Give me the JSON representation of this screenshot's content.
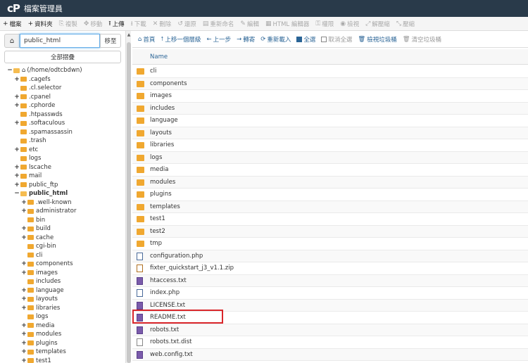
{
  "header": {
    "logo": "cP",
    "title": "檔案管理員"
  },
  "toolbar": [
    {
      "label": "檔案",
      "icon": "+",
      "name": "new-file-button",
      "enabled": true
    },
    {
      "label": "資料夾",
      "icon": "+",
      "name": "new-folder-button",
      "enabled": true
    },
    {
      "label": "複製",
      "icon": "⎘",
      "name": "copy-button",
      "enabled": false
    },
    {
      "label": "移動",
      "icon": "✥",
      "name": "move-button",
      "enabled": false
    },
    {
      "label": "上傳",
      "icon": "⭱",
      "name": "upload-button",
      "enabled": true
    },
    {
      "label": "下載",
      "icon": "⭳",
      "name": "download-button",
      "enabled": false
    },
    {
      "label": "刪除",
      "icon": "✕",
      "name": "delete-button",
      "enabled": false
    },
    {
      "label": "還原",
      "icon": "↺",
      "name": "restore-button",
      "enabled": false
    },
    {
      "label": "重新命名",
      "icon": "▤",
      "name": "rename-button",
      "enabled": false
    },
    {
      "label": "編輯",
      "icon": "✎",
      "name": "edit-button",
      "enabled": false
    },
    {
      "label": "HTML 編輯器",
      "icon": "▦",
      "name": "html-editor-button",
      "enabled": false
    },
    {
      "label": "權限",
      "icon": "⚿",
      "name": "permissions-button",
      "enabled": false
    },
    {
      "label": "檢視",
      "icon": "◉",
      "name": "view-button",
      "enabled": false
    },
    {
      "label": "解壓縮",
      "icon": "⤢",
      "name": "extract-button",
      "enabled": false
    },
    {
      "label": "壓縮",
      "icon": "⤡",
      "name": "compress-button",
      "enabled": false
    }
  ],
  "left": {
    "path_value": "public_html",
    "go_label": "移至",
    "collapse_label": "全部摺疊",
    "tree": [
      {
        "label": "(/home/odtcbdwn)",
        "depth": 0,
        "toggle": "−",
        "home": true,
        "open": true
      },
      {
        "label": ".cagefs",
        "depth": 1,
        "toggle": "+"
      },
      {
        "label": ".cl.selector",
        "depth": 1,
        "toggle": ""
      },
      {
        "label": ".cpanel",
        "depth": 1,
        "toggle": "+"
      },
      {
        "label": ".cphorde",
        "depth": 1,
        "toggle": "+"
      },
      {
        "label": ".htpasswds",
        "depth": 1,
        "toggle": ""
      },
      {
        "label": ".softaculous",
        "depth": 1,
        "toggle": "+"
      },
      {
        "label": ".spamassassin",
        "depth": 1,
        "toggle": ""
      },
      {
        "label": ".trash",
        "depth": 1,
        "toggle": ""
      },
      {
        "label": "etc",
        "depth": 1,
        "toggle": "+"
      },
      {
        "label": "logs",
        "depth": 1,
        "toggle": ""
      },
      {
        "label": "lscache",
        "depth": 1,
        "toggle": "+"
      },
      {
        "label": "mail",
        "depth": 1,
        "toggle": "+"
      },
      {
        "label": "public_ftp",
        "depth": 1,
        "toggle": "+"
      },
      {
        "label": "public_html",
        "depth": 1,
        "toggle": "−",
        "bold": true,
        "open": true
      },
      {
        "label": ".well-known",
        "depth": 2,
        "toggle": "+"
      },
      {
        "label": "administrator",
        "depth": 2,
        "toggle": "+"
      },
      {
        "label": "bin",
        "depth": 2,
        "toggle": ""
      },
      {
        "label": "build",
        "depth": 2,
        "toggle": "+"
      },
      {
        "label": "cache",
        "depth": 2,
        "toggle": "+"
      },
      {
        "label": "cgi-bin",
        "depth": 2,
        "toggle": ""
      },
      {
        "label": "cli",
        "depth": 2,
        "toggle": ""
      },
      {
        "label": "components",
        "depth": 2,
        "toggle": "+"
      },
      {
        "label": "images",
        "depth": 2,
        "toggle": "+"
      },
      {
        "label": "includes",
        "depth": 2,
        "toggle": ""
      },
      {
        "label": "language",
        "depth": 2,
        "toggle": "+"
      },
      {
        "label": "layouts",
        "depth": 2,
        "toggle": "+"
      },
      {
        "label": "libraries",
        "depth": 2,
        "toggle": "+"
      },
      {
        "label": "logs",
        "depth": 2,
        "toggle": ""
      },
      {
        "label": "media",
        "depth": 2,
        "toggle": "+"
      },
      {
        "label": "modules",
        "depth": 2,
        "toggle": "+"
      },
      {
        "label": "plugins",
        "depth": 2,
        "toggle": "+"
      },
      {
        "label": "templates",
        "depth": 2,
        "toggle": "+"
      },
      {
        "label": "test1",
        "depth": 2,
        "toggle": "+"
      }
    ]
  },
  "nav": [
    {
      "label": "首頁",
      "icon": "⌂",
      "name": "home-nav-button"
    },
    {
      "label": "上移一個層級",
      "icon": "⭡",
      "name": "up-level-button"
    },
    {
      "label": "上一步",
      "icon": "←",
      "name": "back-button"
    },
    {
      "label": "轉寄",
      "icon": "→",
      "name": "forward-button"
    },
    {
      "label": "重新載入",
      "icon": "⟳",
      "name": "reload-button"
    },
    {
      "label": "全選",
      "icon": "☑",
      "name": "select-all-button",
      "checkbox": "checked"
    },
    {
      "label": "取消全選",
      "icon": "☐",
      "name": "deselect-all-button",
      "checkbox": "empty",
      "disabled": true
    },
    {
      "label": "檢視垃圾桶",
      "icon": "🗑",
      "name": "view-trash-button"
    },
    {
      "label": "清空垃圾桶",
      "icon": "🗑",
      "name": "empty-trash-button",
      "disabled": true
    }
  ],
  "table": {
    "header": "Name",
    "rows": [
      {
        "name": "cli",
        "type": "folder"
      },
      {
        "name": "components",
        "type": "folder"
      },
      {
        "name": "images",
        "type": "folder"
      },
      {
        "name": "includes",
        "type": "folder"
      },
      {
        "name": "language",
        "type": "folder"
      },
      {
        "name": "layouts",
        "type": "folder"
      },
      {
        "name": "libraries",
        "type": "folder"
      },
      {
        "name": "logs",
        "type": "folder"
      },
      {
        "name": "media",
        "type": "folder"
      },
      {
        "name": "modules",
        "type": "folder"
      },
      {
        "name": "plugins",
        "type": "folder"
      },
      {
        "name": "templates",
        "type": "folder"
      },
      {
        "name": "test1",
        "type": "folder"
      },
      {
        "name": "test2",
        "type": "folder"
      },
      {
        "name": "tmp",
        "type": "folder"
      },
      {
        "name": "configuration.php",
        "type": "php"
      },
      {
        "name": "fixter_quickstart_j3_v1.1.zip",
        "type": "zip"
      },
      {
        "name": "htaccess.txt",
        "type": "txt"
      },
      {
        "name": "index.php",
        "type": "php"
      },
      {
        "name": "LICENSE.txt",
        "type": "txt"
      },
      {
        "name": "README.txt",
        "type": "txt"
      },
      {
        "name": "robots.txt",
        "type": "txt"
      },
      {
        "name": "robots.txt.dist",
        "type": "plain"
      },
      {
        "name": "web.config.txt",
        "type": "txt"
      }
    ]
  },
  "colors": {
    "header_bg": "#293a4a",
    "link": "#2a6496",
    "folder": "#f0a830",
    "highlight": "#d9262b"
  }
}
